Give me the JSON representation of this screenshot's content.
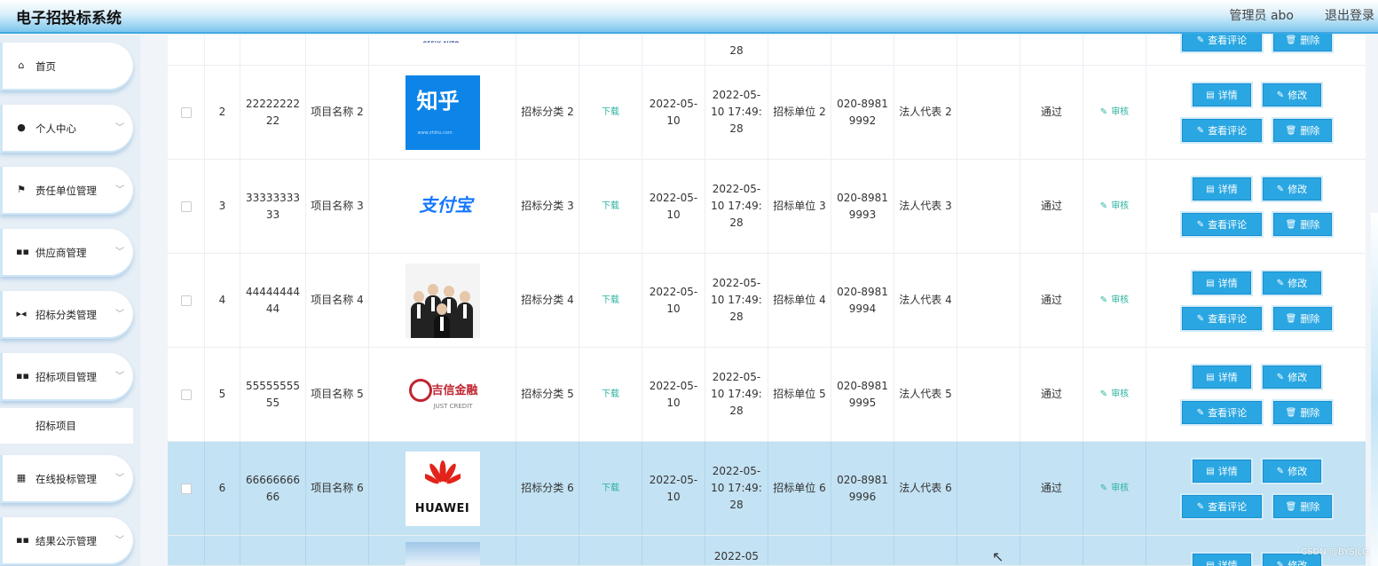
{
  "header": {
    "title": "电子招投标系统",
    "admin_label": "管理员 abo",
    "logout_label": "退出登录"
  },
  "sidebar": {
    "items": [
      {
        "label": "首页",
        "icon": "home-icon",
        "glyph": "⌂"
      },
      {
        "label": "个人中心",
        "icon": "user-icon",
        "glyph": "●"
      },
      {
        "label": "责任单位管理",
        "icon": "flag-icon",
        "glyph": "⚑"
      },
      {
        "label": "供应商管理",
        "icon": "grid-icon",
        "glyph": "▪▪"
      },
      {
        "label": "招标分类管理",
        "icon": "category-icon",
        "glyph": "▶◀"
      },
      {
        "label": "招标项目管理",
        "icon": "grid-icon",
        "glyph": "▪▪"
      },
      {
        "label": "在线投标管理",
        "icon": "grid9-icon",
        "glyph": "▦"
      },
      {
        "label": "结果公示管理",
        "icon": "grid-icon",
        "glyph": "▪▪"
      }
    ],
    "sub_item_label": "招标项目"
  },
  "table": {
    "download_label": "下载",
    "review_label": "审核",
    "buttons": {
      "detail": "详情",
      "edit": "修改",
      "comment": "查看评论",
      "delete": "删除"
    },
    "top_row": {
      "time_last": "28",
      "logo": "GEELY AUTO"
    },
    "rows": [
      {
        "idx": "2",
        "code": "22222222 22",
        "name": "项目名称 2",
        "logo": "知乎",
        "logo_sub": "www.zhihu.com",
        "category": "招标分类 2",
        "date": "2022-05- 10",
        "time": "2022-05- 10 17:49: 28",
        "unit": "招标单位 2",
        "tel": "020-8981 9992",
        "rep": "法人代表 2",
        "status": "通过"
      },
      {
        "idx": "3",
        "code": "33333333 33",
        "name": "项目名称 3",
        "logo": "支付宝",
        "category": "招标分类 3",
        "date": "2022-05- 10",
        "time": "2022-05- 10 17:49: 28",
        "unit": "招标单位 3",
        "tel": "020-8981 9993",
        "rep": "法人代表 3",
        "status": "通过"
      },
      {
        "idx": "4",
        "code": "44444444 44",
        "name": "项目名称 4",
        "category": "招标分类 4",
        "date": "2022-05- 10",
        "time": "2022-05- 10 17:49: 28",
        "unit": "招标单位 4",
        "tel": "020-8981 9994",
        "rep": "法人代表 4",
        "status": "通过"
      },
      {
        "idx": "5",
        "code": "55555555 55",
        "name": "项目名称 5",
        "logo": "吉信金融",
        "logo_sub": "JUST CREDIT",
        "category": "招标分类 5",
        "date": "2022-05- 10",
        "time": "2022-05- 10 17:49: 28",
        "unit": "招标单位 5",
        "tel": "020-8981 9995",
        "rep": "法人代表 5",
        "status": "通过"
      },
      {
        "idx": "6",
        "code": "66666666 66",
        "name": "项目名称 6",
        "logo": "HUAWEI",
        "category": "招标分类 6",
        "date": "2022-05- 10",
        "time": "2022-05- 10 17:49: 28",
        "unit": "招标单位 6",
        "tel": "020-8981 9996",
        "rep": "法人代表 6",
        "status": "通过"
      }
    ],
    "bottom_row": {
      "time_first": "2022-05"
    }
  },
  "watermark": "CSDN @BYSJLG",
  "colors": {
    "accent": "#2aa7e2",
    "highlight_row": "#c3e2f3",
    "link": "#2bb3a0"
  }
}
